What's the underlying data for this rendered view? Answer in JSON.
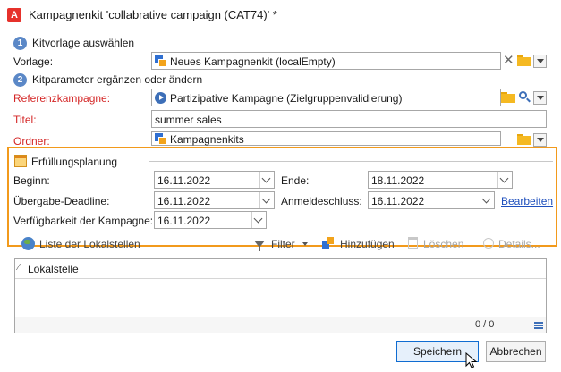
{
  "window": {
    "title": "Kampagnenkit 'collabrative campaign  (CAT74)' *",
    "logo_glyph": "A"
  },
  "step1": {
    "number": "1",
    "label": "Kitvorlage auswählen"
  },
  "step2": {
    "number": "2",
    "label": "Kitparameter ergänzen oder ändern"
  },
  "fields": {
    "vorlage": {
      "label": "Vorlage:",
      "value": "Neues Kampagnenkit (localEmpty)"
    },
    "referenzkampagne": {
      "label": "Referenzkampagne:",
      "value": "Partizipative Kampagne (Zielgruppenvalidierung)"
    },
    "titel": {
      "label": "Titel:",
      "value": "summer sales"
    },
    "ordner": {
      "label": "Ordner:",
      "value": "Kampagnenkits"
    }
  },
  "fulfillment": {
    "group_label": "Erfüllungsplanung",
    "beginn": {
      "label": "Beginn:",
      "value": "16.11.2022"
    },
    "ende": {
      "label": "Ende:",
      "value": "18.11.2022"
    },
    "uebergabe": {
      "label": "Übergabe-Deadline:",
      "value": "16.11.2022"
    },
    "anmeldeschluss": {
      "label": "Anmeldeschluss:",
      "value": "16.11.2022"
    },
    "bearbeiten_link": "Bearbeiten",
    "verfuegbarkeit": {
      "label": "Verfügbarkeit der Kampagne:",
      "value": "16.11.2022"
    }
  },
  "toolbar": {
    "liste": "Liste der Lokalstellen",
    "filter": "Filter",
    "hinzufuegen": "Hinzufügen",
    "loeschen": "Löschen",
    "details": "Details..."
  },
  "grid": {
    "sort_mark": "⁄",
    "column": "Lokalstelle",
    "count": "0 / 0"
  },
  "buttons": {
    "save": "Speichern",
    "cancel": "Abbrechen"
  },
  "colors": {
    "accent_orange": "#f29a1c",
    "required_red": "#d42626",
    "link_blue": "#1e4fbd",
    "step_blue": "#5b88c7"
  }
}
